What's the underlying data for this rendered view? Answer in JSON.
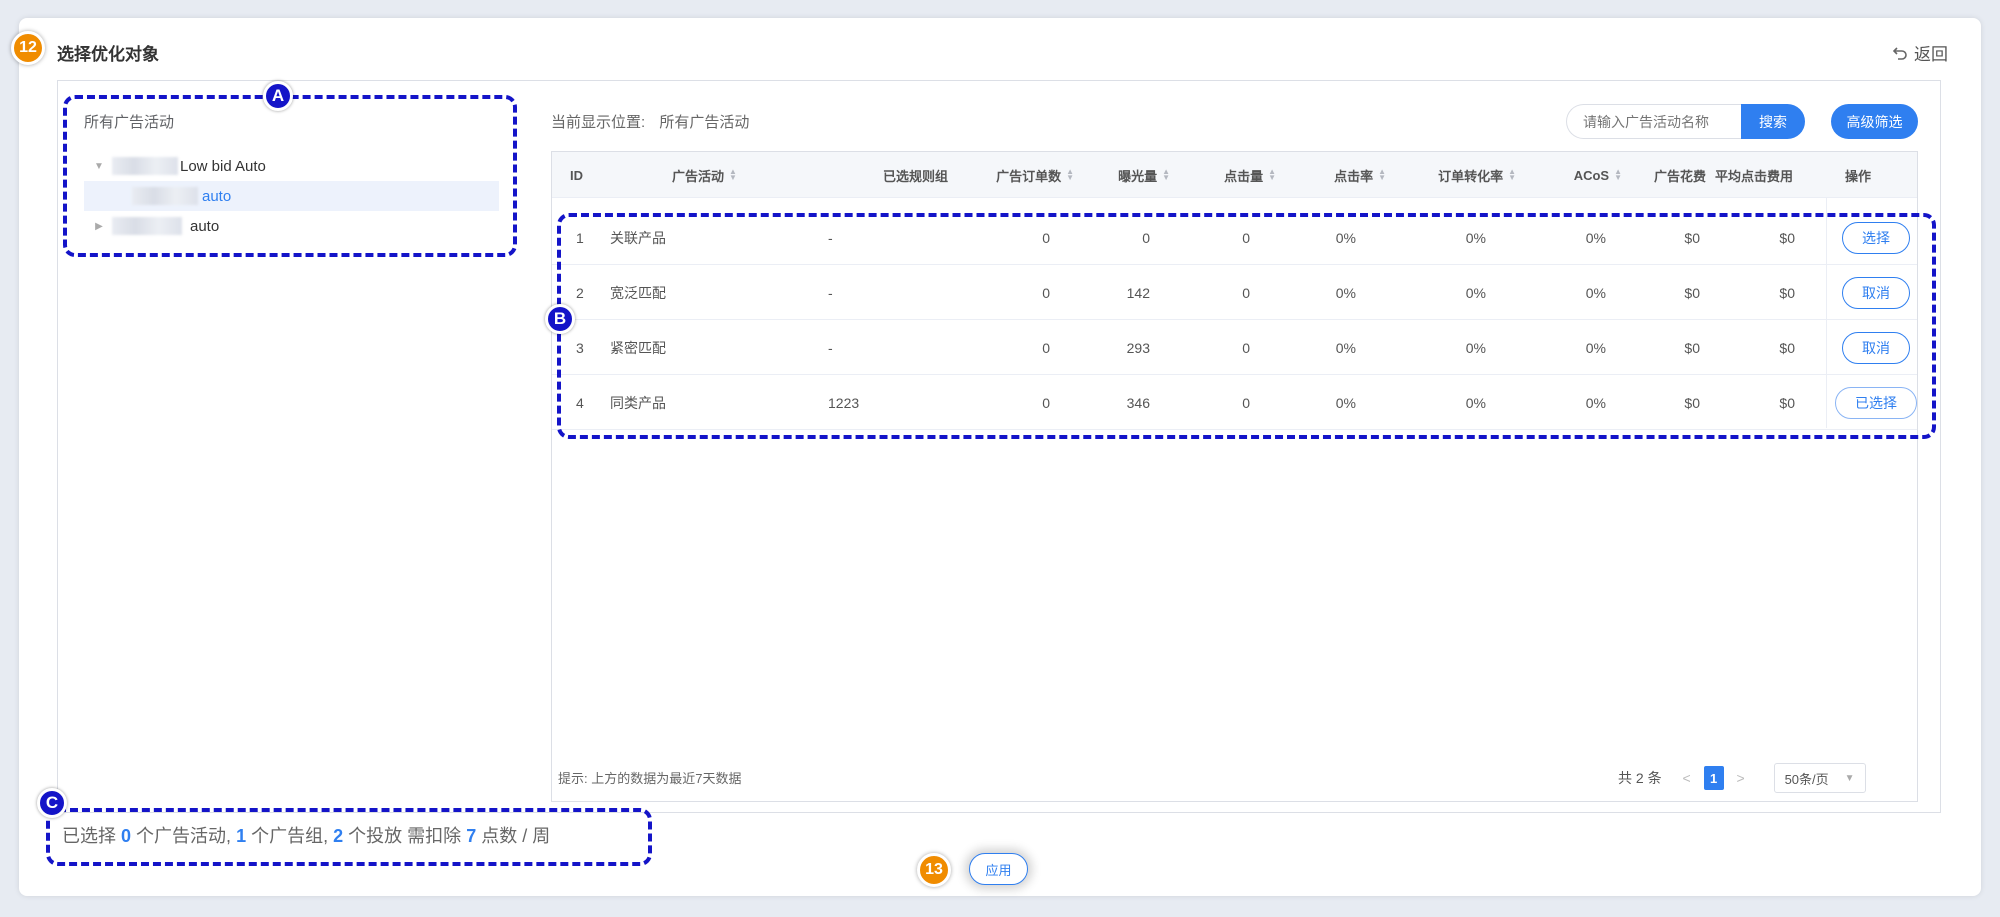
{
  "header": {
    "step": "12",
    "title": "选择优化对象",
    "back_label": "返回"
  },
  "tree": {
    "root_label": "所有广告活动",
    "nodes": [
      {
        "label": "Low bid Auto",
        "expanded": true
      },
      {
        "label": "auto",
        "selected": true
      },
      {
        "label": "auto",
        "expanded": false
      }
    ]
  },
  "location": {
    "label": "当前显示位置:",
    "value": "所有广告活动"
  },
  "search": {
    "placeholder": "请输入广告活动名称",
    "button": "搜索"
  },
  "advanced_filter": "高级筛选",
  "table": {
    "columns": [
      "ID",
      "广告活动",
      "已选规则组",
      "广告订单数",
      "曝光量",
      "点击量",
      "点击率",
      "订单转化率",
      "ACoS",
      "广告花费",
      "平均点击费用",
      "操作"
    ],
    "rows": [
      {
        "id": "1",
        "name": "关联产品",
        "rule_group": "-",
        "orders": "0",
        "impressions": "0",
        "clicks": "0",
        "ctr": "0%",
        "cvr": "0%",
        "acos": "0%",
        "spend": "$0",
        "cpc": "$0",
        "action": "选择"
      },
      {
        "id": "2",
        "name": "宽泛匹配",
        "rule_group": "-",
        "orders": "0",
        "impressions": "142",
        "clicks": "0",
        "ctr": "0%",
        "cvr": "0%",
        "acos": "0%",
        "spend": "$0",
        "cpc": "$0",
        "action": "取消"
      },
      {
        "id": "3",
        "name": "紧密匹配",
        "rule_group": "-",
        "orders": "0",
        "impressions": "293",
        "clicks": "0",
        "ctr": "0%",
        "cvr": "0%",
        "acos": "0%",
        "spend": "$0",
        "cpc": "$0",
        "action": "取消"
      },
      {
        "id": "4",
        "name": "同类产品",
        "rule_group": "1223",
        "orders": "0",
        "impressions": "346",
        "clicks": "0",
        "ctr": "0%",
        "cvr": "0%",
        "acos": "0%",
        "spend": "$0",
        "cpc": "$0",
        "action": "已选择"
      }
    ]
  },
  "hint": "提示: 上方的数据为最近7天数据",
  "pagination": {
    "total": "共 2 条",
    "current": "1",
    "page_size": "50条/页"
  },
  "summary": {
    "p1": "已选择",
    "campaigns": "0",
    "p2": "个广告活动,",
    "groups": "1",
    "p3": "个广告组,",
    "targets": "2",
    "p4": "个投放 需扣除",
    "points": "7",
    "p5": "点数 / 周"
  },
  "apply": {
    "step": "13",
    "label": "应用"
  },
  "annotations": {
    "a": "A",
    "b": "B",
    "c": "C"
  },
  "colors": {
    "primary": "#2f7ff0",
    "annotation": "#1414c8",
    "step_badge": "#f08c00"
  }
}
